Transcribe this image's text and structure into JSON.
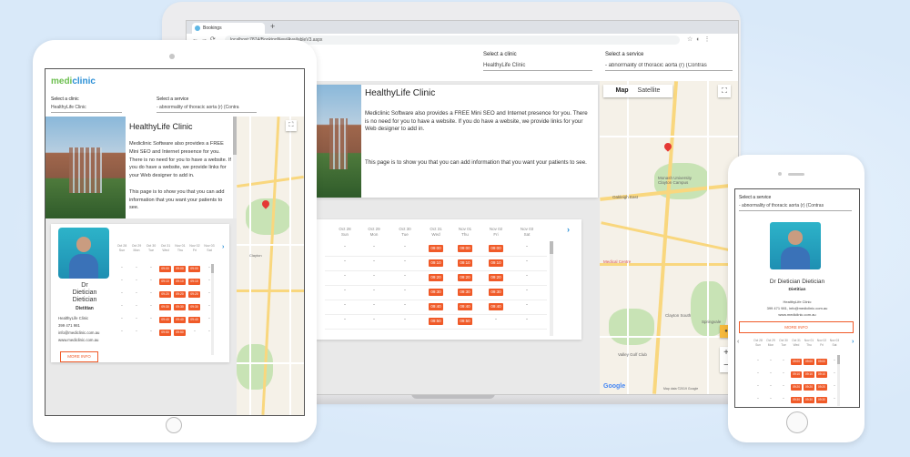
{
  "clinic": {
    "select_clinic_label": "Select a clinic",
    "selected_clinic": "HealthyLife Clinic",
    "select_service_label": "Select a service",
    "selected_service": "- abnormality of thoracic aorta (r) (Contras",
    "selected_service_short": "- abnormality of thoracic aorta (r) (Contra",
    "title": "HealthyLife Clinic",
    "description_1": "Mediclinic Software also provides a FREE Mini SEO and Internet presence for you.  There is no need for you to have a website.  If you do have a website, we provide links for your Web designer to add in.",
    "description_2": "This page is to show you that you can add information that you want your patients to see."
  },
  "logo": {
    "part1": "medi",
    "part2": "clinic"
  },
  "browser": {
    "tab_title": "Bookings",
    "url": "localhost:7874/BookingNew/AvailableV3.aspx"
  },
  "map": {
    "tab_map": "Map",
    "tab_satellite": "Satellite",
    "labels": [
      "Oakleigh East",
      "Monash University Clayton Campus",
      "Medical Centre",
      "Clayton South",
      "Valley Golf Club",
      "Springvale",
      "Clayton"
    ],
    "google": "Google",
    "footer": "Map data ©2019 Google"
  },
  "schedule": {
    "days": [
      {
        "date": "Oct 28",
        "dow": "Sun"
      },
      {
        "date": "Oct 29",
        "dow": "Mon"
      },
      {
        "date": "Oct 30",
        "dow": "Tue"
      },
      {
        "date": "Oct 31",
        "dow": "Wed"
      },
      {
        "date": "Nov 01",
        "dow": "Thu"
      },
      {
        "date": "Nov 02",
        "dow": "Fri"
      },
      {
        "date": "Nov 03",
        "dow": "Sat"
      }
    ],
    "slots": [
      "09:00",
      "09:10",
      "09:20",
      "09:30",
      "09:40",
      "09:50"
    ],
    "dash": "-"
  },
  "doctor": {
    "name_full": "Dr Dietician Dietician",
    "name_line1": "Dr",
    "name_line2": "Dietician",
    "name_line3": "Dietician",
    "title": "Dietitian",
    "clinic": "HealthyLife Clinic",
    "phone": "399 471 981",
    "email": "info@mediclinic.com.au",
    "website": "www.mediclinic.com.au",
    "phone_email": "399 471 981, info@mediclinic.com.au",
    "more_info": "MORE INFO"
  }
}
